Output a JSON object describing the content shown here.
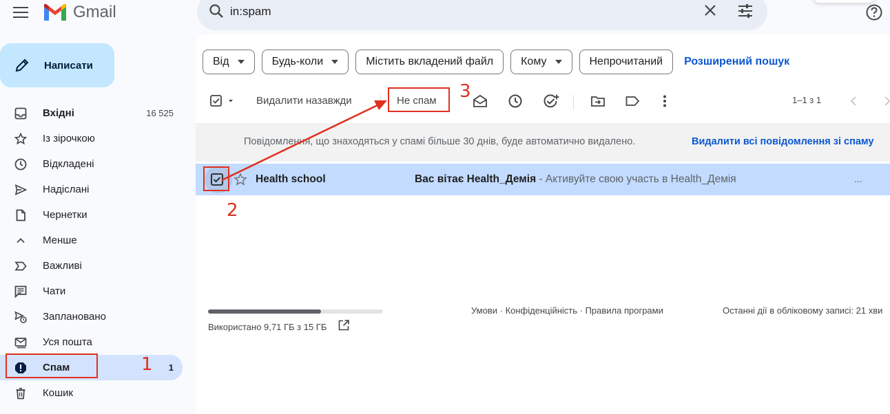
{
  "header": {
    "app_name": "Gmail",
    "search_value": "in:spam",
    "icons": [
      "menu-icon",
      "gmail-logo-icon",
      "search-icon",
      "clear-search-icon",
      "search-options-icon",
      "help-icon"
    ]
  },
  "sidebar": {
    "compose_label": "Написати",
    "items": [
      {
        "label": "Вхідні",
        "count": "16 525",
        "icon": "inbox-icon"
      },
      {
        "label": "Із зірочкою",
        "count": "",
        "icon": "star-icon"
      },
      {
        "label": "Відкладені",
        "count": "",
        "icon": "clock-icon"
      },
      {
        "label": "Надіслані",
        "count": "",
        "icon": "send-icon"
      },
      {
        "label": "Чернетки",
        "count": "",
        "icon": "draft-icon"
      },
      {
        "label": "Менше",
        "count": "",
        "icon": "chevron-up-icon"
      },
      {
        "label": "Важливі",
        "count": "",
        "icon": "important-icon"
      },
      {
        "label": "Чати",
        "count": "",
        "icon": "chat-icon"
      },
      {
        "label": "Заплановано",
        "count": "",
        "icon": "scheduled-icon"
      },
      {
        "label": "Уся пошта",
        "count": "",
        "icon": "all-mail-icon"
      },
      {
        "label": "Спам",
        "count": "1",
        "icon": "spam-icon"
      },
      {
        "label": "Кошик",
        "count": "",
        "icon": "trash-icon"
      }
    ]
  },
  "filters": {
    "chips": [
      "Від",
      "Будь-коли",
      "Містить вкладений файл",
      "Кому",
      "Непрочитаний"
    ],
    "advanced_search": "Розширений пошук"
  },
  "toolbar": {
    "delete_forever": "Видалити назавжди",
    "not_spam": "Не спам",
    "pager": "1–1 з 1"
  },
  "notice": {
    "text": "Повідомлення, що знаходяться у спамі більше 30 днів, буде автоматично видалено.",
    "link": "Видалити всі повідомлення зі спаму"
  },
  "messages": [
    {
      "sender": "Health school",
      "subject": "Вас вітає Health_Демія",
      "snippet": " - Активуйте свою участь в Health_Демія",
      "checked": true,
      "more": "..."
    }
  ],
  "footer": {
    "storage_text": "Використано 9,71 ГБ з 15 ГБ",
    "storage_fraction": 0.647,
    "links": "Умови · Конфіденційність · Правила програми",
    "activity": "Останні дії в обліковому записі: 21 хви"
  },
  "annotations": {
    "step1": "1",
    "step2": "2",
    "step3": "3",
    "color": "#e0301e"
  },
  "colors": {
    "accent": "#0b57d0",
    "compose_bg": "#c2e7ff",
    "selected_row": "#c2dbff",
    "active_nav": "#d3e3fd"
  }
}
